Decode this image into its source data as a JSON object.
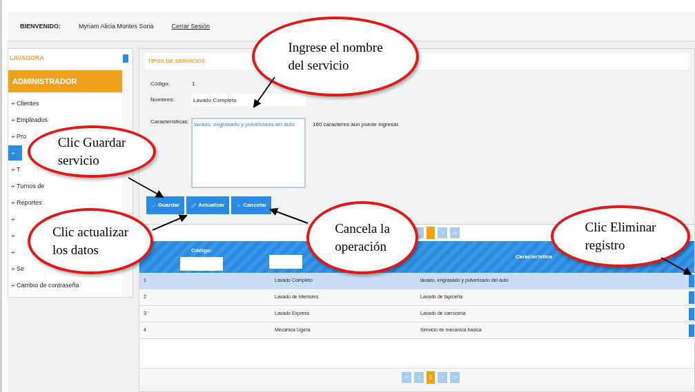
{
  "header": {
    "greeting": "BIENVENIDO:",
    "user": "Myriam Alicia Montes Soria",
    "logout": "Cerrar Sesión"
  },
  "sidebar": {
    "title": "LAVADORA",
    "section": "ADMINISTRADOR",
    "items": [
      {
        "label": "Clientes",
        "selected": false
      },
      {
        "label": "Empleados",
        "selected": false
      },
      {
        "label": "Pro",
        "selected": false
      },
      {
        "selected": true
      },
      {
        "label": "T",
        "selected": false
      },
      {
        "label": "Turnos de",
        "selected": false
      },
      {
        "label": "Reportes",
        "selected": false
      },
      {
        "selected": false
      },
      {
        "selected": false
      },
      {
        "selected": false
      },
      {
        "label": "Se",
        "selected": false
      },
      {
        "label": "Cambio de contraseña",
        "selected": false
      }
    ]
  },
  "form": {
    "title": "TIPOS DE SERVICIOS",
    "code_label": "Código:",
    "code_value": "1",
    "name_label": "Nombres:",
    "name_value": "Lavado Completo",
    "features_label": "Características:",
    "features_value": "lavado, engrasado y pulverizado del auto",
    "features_hint": "160 caracteres aún puede ingresar.",
    "buttons": [
      "Guardar",
      "Actualizar",
      "Cancelar"
    ]
  },
  "table": {
    "columns": [
      "Código:",
      "Característica"
    ],
    "rows": [
      {
        "cells": [
          "1",
          "Lavado Completo",
          "lavado, engrasado y pulverizado del auto"
        ],
        "selected": true
      },
      {
        "cells": [
          "2",
          "Lavado de interiores",
          "Lavado de tapiceria"
        ],
        "selected": false
      },
      {
        "cells": [
          "3",
          "Lavado Express",
          "Lavado de carroceria"
        ],
        "selected": false
      },
      {
        "cells": [
          "4",
          "Mecanica Ligera",
          "Servicio de mecanica basica"
        ],
        "selected": false
      }
    ],
    "pager": {
      "current": "1"
    }
  },
  "callouts": [
    {
      "text": "Ingrese el nombre\ndel servicio"
    },
    {
      "text": "Clic Guardar\nservicio"
    },
    {
      "text": "Clic actualizar\nlos datos"
    },
    {
      "text": "Cancela la\noperación"
    },
    {
      "text": "Clic Eliminar\nregistro"
    }
  ]
}
